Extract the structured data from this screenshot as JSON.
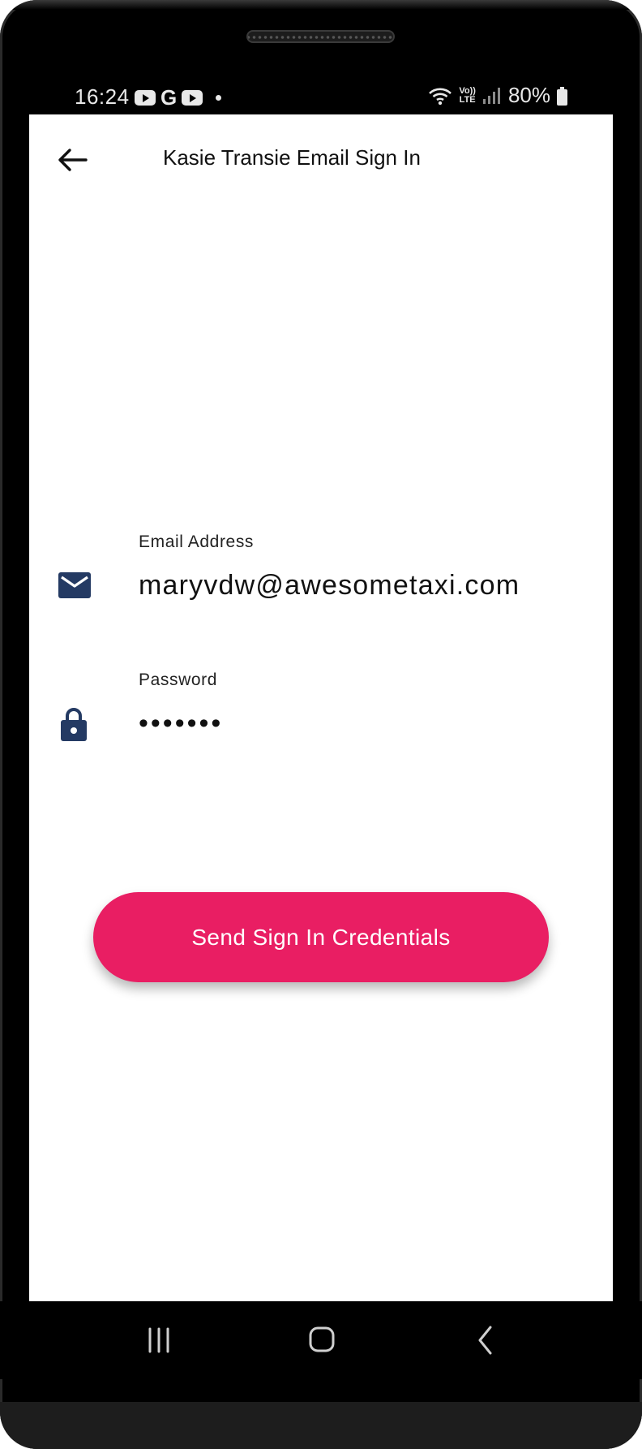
{
  "status_bar": {
    "time": "16:24",
    "notification_icons": [
      "youtube-icon",
      "google-icon",
      "youtube-icon",
      "dot-icon"
    ],
    "system_icons": [
      "wifi-icon",
      "volte-icon",
      "signal-icon"
    ],
    "volte_label": "Vo)) LTE",
    "battery_percent": "80%"
  },
  "app_bar": {
    "back_icon": "arrow-left-icon",
    "title": "Kasie Transie Email Sign In"
  },
  "form": {
    "email": {
      "label": "Email Address",
      "value": "maryvdw@awesometaxi.com",
      "icon": "email-icon"
    },
    "password": {
      "label": "Password",
      "value": "•••••••",
      "icon": "lock-icon"
    },
    "submit_label": "Send Sign In Credentials"
  },
  "nav_bar": {
    "buttons": [
      "recent-apps-icon",
      "home-icon",
      "back-icon"
    ]
  },
  "colors": {
    "accent": "#e91e63",
    "icon_navy": "#243a63",
    "text": "#111111",
    "background": "#ffffff"
  }
}
